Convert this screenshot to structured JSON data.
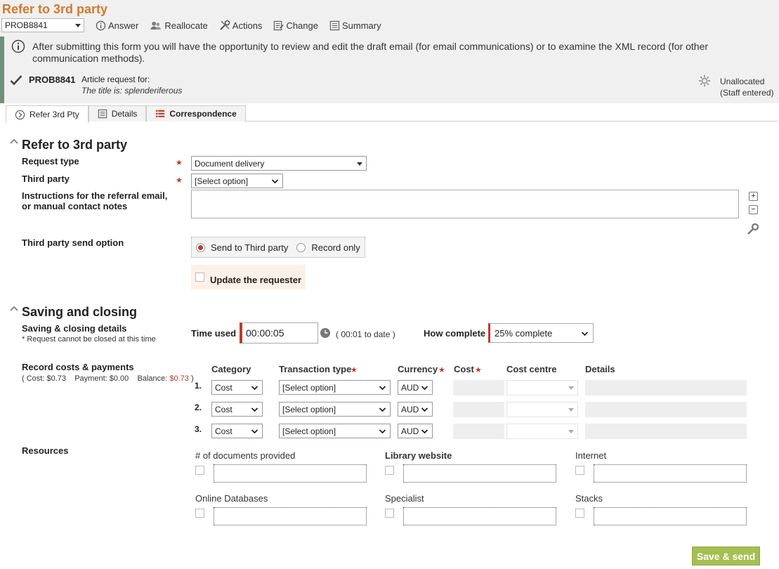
{
  "header": {
    "title": "Refer to 3rd party"
  },
  "toolbar": {
    "record_value": "PROB8841",
    "answer": "Answer",
    "reallocate": "Reallocate",
    "actions": "Actions",
    "change": "Change",
    "summary": "Summary"
  },
  "info": {
    "message": "After submitting this form you will have the opportunity to review and edit the draft email (for email communications) or to examine the XML record (for other communication methods)."
  },
  "problem": {
    "id": "PROB8841",
    "article": "Article request for:",
    "title": "The title is: splenderiferous",
    "status_line1": "Unallocated",
    "status_line2": "(Staff entered)"
  },
  "tabs": [
    {
      "label": "Refer 3rd Pty"
    },
    {
      "label": "Details"
    },
    {
      "label": "Correspondence"
    }
  ],
  "refer": {
    "heading": "Refer to 3rd party",
    "request_type_label": "Request type",
    "request_type_value": "Document delivery",
    "third_party_label": "Third party",
    "third_party_value": "[Select option]",
    "instructions_label_1": "Instructions for the referral email,",
    "instructions_label_2": "or manual contact notes",
    "send_option_label": "Third party send option",
    "send_option_1": "Send to Third party",
    "send_option_2": "Record only",
    "update_requester": "Update the requester",
    "required_mark": "★"
  },
  "saving": {
    "heading": "Saving and closing",
    "details_label": "Saving & closing details",
    "details_note": "* Request cannot be closed at this time",
    "time_used_label": "Time used",
    "time_used_value": "00:00:05",
    "to_date": "( 00:01 to date )",
    "how_complete_label": "How complete",
    "how_complete_value": "25% complete"
  },
  "costs": {
    "label": "Record costs & payments",
    "cost_prefix": "( Cost: $0.73",
    "payment": "Payment: $0.00",
    "balance_label": "Balance:",
    "balance_value": "$0.73",
    "close_paren": ")",
    "headers": {
      "category": "Category",
      "transaction": "Transaction type",
      "currency": "Currency",
      "cost": "Cost",
      "cost_centre": "Cost centre",
      "details": "Details"
    },
    "rows": [
      {
        "num": "1.",
        "category": "Cost",
        "transaction": "[Select option]",
        "currency": "AUD"
      },
      {
        "num": "2.",
        "category": "Cost",
        "transaction": "[Select option]",
        "currency": "AUD"
      },
      {
        "num": "3.",
        "category": "Cost",
        "transaction": "[Select option]",
        "currency": "AUD"
      }
    ]
  },
  "resources": {
    "label": "Resources",
    "items": [
      {
        "label": "# of documents provided"
      },
      {
        "label": "Library website"
      },
      {
        "label": "Internet"
      },
      {
        "label": "Online Databases"
      },
      {
        "label": "Specialist"
      },
      {
        "label": "Stacks"
      }
    ]
  },
  "save_button": "Save & send",
  "colors": {
    "accent": "#d3792b",
    "required": "#c0392b",
    "save": "#a6bf52"
  }
}
